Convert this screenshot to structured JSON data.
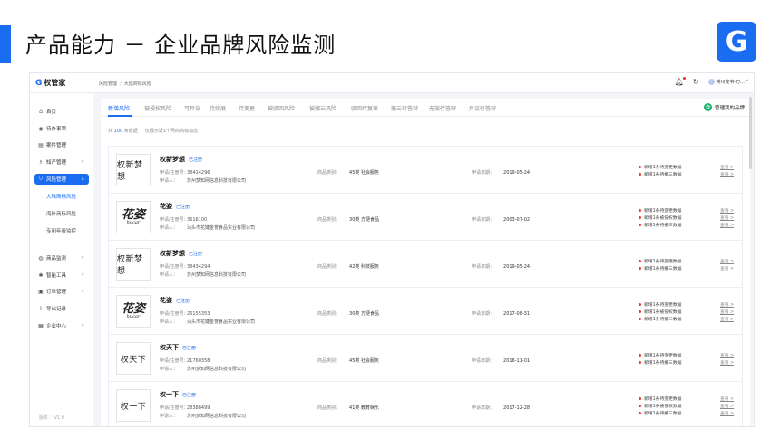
{
  "slide": {
    "title": "产品能力 － 企业品牌风险监测",
    "logo_glyph": "G"
  },
  "app": {
    "brand": "权管家",
    "brand_icon": "G",
    "breadcrumb": [
      "风险管理",
      "大陆商标风险"
    ],
    "user": "常州龙书·万... ˅",
    "version": "版本： V1.0"
  },
  "sidebar": {
    "items": [
      {
        "icon": "home-icon",
        "glyph": "⌂",
        "label": "首页",
        "chev": ""
      },
      {
        "icon": "todo-icon",
        "glyph": "◉",
        "label": "待办事项",
        "chev": ""
      },
      {
        "icon": "case-icon",
        "glyph": "▤",
        "label": "案件管理",
        "chev": ""
      },
      {
        "icon": "ip-icon",
        "glyph": "♗",
        "label": "知产管理",
        "chev": "∨"
      },
      {
        "icon": "risk-icon",
        "glyph": "⛉",
        "label": "风险管理",
        "chev": "∧"
      },
      {
        "icon": "goods-icon",
        "glyph": "◍",
        "label": "商品监测",
        "chev": "∨"
      },
      {
        "icon": "tool-icon",
        "glyph": "✱",
        "label": "智能工具",
        "chev": "∨"
      },
      {
        "icon": "order-icon",
        "glyph": "▣",
        "label": "订单管理",
        "chev": "∨"
      },
      {
        "icon": "export-icon",
        "glyph": "⇩",
        "label": "导出记录",
        "chev": ""
      },
      {
        "icon": "company-icon",
        "glyph": "▦",
        "label": "企业中心",
        "chev": "∨"
      }
    ],
    "sub_items": [
      "大陆商标风险",
      "海外商标风险",
      "专利年费监控"
    ]
  },
  "tabs": [
    "新增风险",
    "被侵权风险",
    "可异议",
    "待续展",
    "待变更",
    "被驳回风险",
    "被撤三风险",
    "驳回待复审",
    "撤三待答辩",
    "无效待答辩",
    "异议待答辩"
  ],
  "manage_button": "管理我的品牌",
  "summary": {
    "prefix": "共",
    "count": "100",
    "suffix": "条数据 ｜ 仅展示近1个月的商标动态"
  },
  "labels": {
    "reg_no": "申请/注册号：",
    "applicant": "申请人：",
    "class": "商品类别：",
    "date": "申请日期：",
    "view": "查看 >"
  },
  "rows": [
    {
      "logo_text": "权新梦想",
      "logo_style": "serif",
      "name": "权新梦想",
      "status": "已注册",
      "reg_no": "38414296",
      "applicant": "苏州梦知网信息科技有限公司",
      "class": "45类 社会服务",
      "date": "2019-05-24",
      "alerts": [
        "新增1条待变更数据",
        "新增1条待撤三数据"
      ]
    },
    {
      "logo_text": "花姿",
      "logo_sub": "hucar",
      "logo_style": "brush",
      "name": "花姿",
      "status": "已注册",
      "reg_no": "3616100",
      "applicant": "汕头市花婕金誉食品实业有限公司",
      "class": "30类 方便食品",
      "date": "2003-07-02",
      "alerts": [
        "新增1条待变更数据",
        "新增1条被侵权数据",
        "新增1条待撤三数据"
      ]
    },
    {
      "logo_text": "权新梦想",
      "logo_style": "serif",
      "name": "权新梦想",
      "status": "已注册",
      "reg_no": "38434294",
      "applicant": "苏州梦知网信息科技有限公司",
      "class": "42类 科技服务",
      "date": "2019-05-24",
      "alerts": [
        "新增1条待变更数据",
        "新增1条待撤三数据"
      ]
    },
    {
      "logo_text": "花姿",
      "logo_sub": "hucar",
      "logo_style": "brush",
      "name": "花姿",
      "status": "已注册",
      "reg_no": "26155353",
      "applicant": "汕头市花婕金誉食品实业有限公司",
      "class": "30类 方便食品",
      "date": "2017-08-31",
      "alerts": [
        "新增1条待变更数据",
        "新增1条被侵权数据",
        "新增1条待撤三数据"
      ]
    },
    {
      "logo_text": "权天下",
      "logo_style": "serif",
      "name": "权天下",
      "status": "已注册",
      "reg_no": "21760358",
      "applicant": "苏州梦知网信息科技有限公司",
      "class": "45类 社会服务",
      "date": "2016-11-01",
      "alerts": [
        "新增1条待变更数据",
        "新增1条待撤三数据"
      ]
    },
    {
      "logo_text": "权一下",
      "logo_style": "serif",
      "name": "权一下",
      "status": "已注册",
      "reg_no": "28388499",
      "applicant": "苏州梦知网信息科技有限公司",
      "class": "41类 教育娱乐",
      "date": "2017-12-28",
      "alerts": [
        "新增1条待变更数据",
        "新增1条被侵权数据",
        "新增1条待撤三数据"
      ]
    }
  ],
  "colors": {
    "accent": "#1a6cf0",
    "alert": "#e33333",
    "success": "#19b56a"
  }
}
